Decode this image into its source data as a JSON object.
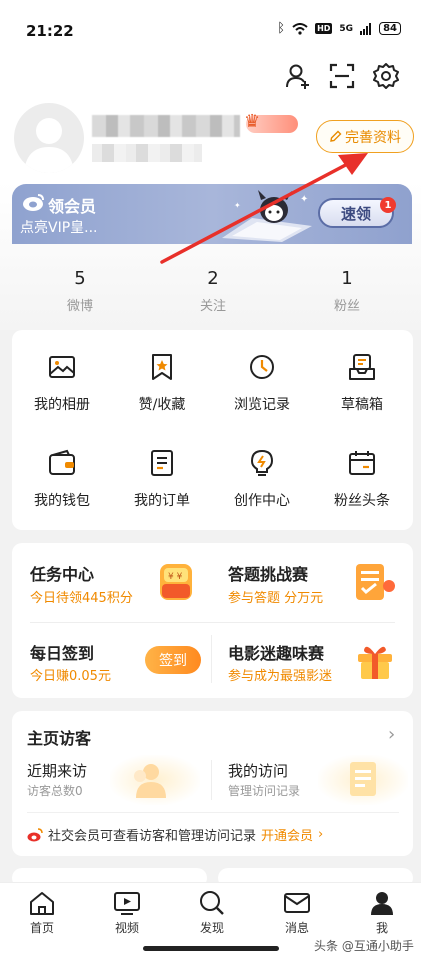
{
  "status_bar": {
    "time": "21:22",
    "battery": "84",
    "hd": "HD",
    "signal_label": "5G"
  },
  "header_icons": [
    "add-friend-icon",
    "scan-icon",
    "settings-icon"
  ],
  "profile": {
    "complete_profile_label": "完善资料"
  },
  "vip_banner": {
    "title": "领会员",
    "subtitle": "点亮VIP皇...",
    "speed_button": "速领",
    "badge_count": "1"
  },
  "stats": [
    {
      "value": "5",
      "label": "微博"
    },
    {
      "value": "2",
      "label": "关注"
    },
    {
      "value": "1",
      "label": "粉丝"
    }
  ],
  "tools": [
    {
      "label": "我的相册",
      "icon": "photo-icon"
    },
    {
      "label": "赞/收藏",
      "icon": "favorite-icon"
    },
    {
      "label": "浏览记录",
      "icon": "history-icon"
    },
    {
      "label": "草稿箱",
      "icon": "drafts-icon"
    },
    {
      "label": "我的钱包",
      "icon": "wallet-icon"
    },
    {
      "label": "我的订单",
      "icon": "order-icon"
    },
    {
      "label": "创作中心",
      "icon": "creator-icon"
    },
    {
      "label": "粉丝头条",
      "icon": "fans-headline-icon"
    }
  ],
  "tasks": {
    "task_center_title": "任务中心",
    "task_center_sub": "今日待领445积分",
    "quiz_title": "答题挑战赛",
    "quiz_sub": "参与答题 分万元",
    "checkin_title": "每日签到",
    "checkin_sub": "今日赚0.05元",
    "checkin_button": "签到",
    "movie_title": "电影迷趣味赛",
    "movie_sub": "参与成为最强影迷"
  },
  "visitors": {
    "title": "主页访客",
    "recent_title": "近期来访",
    "recent_sub": "访客总数0",
    "my_visits_title": "我的访问",
    "my_visits_sub": "管理访问记录",
    "promo_text": "社交会员可查看访客和管理访问记录",
    "promo_link": "开通会员"
  },
  "bottom_nav": [
    {
      "label": "首页",
      "icon": "home-icon"
    },
    {
      "label": "视频",
      "icon": "video-icon"
    },
    {
      "label": "发现",
      "icon": "discover-icon"
    },
    {
      "label": "消息",
      "icon": "message-icon"
    },
    {
      "label": "我",
      "icon": "me-icon"
    }
  ],
  "watermark": "头条 @互通小助手",
  "colors": {
    "accent_orange": "#f08a00",
    "arrow_red": "#e8302a",
    "vip_blue": "#8fa2cf"
  }
}
